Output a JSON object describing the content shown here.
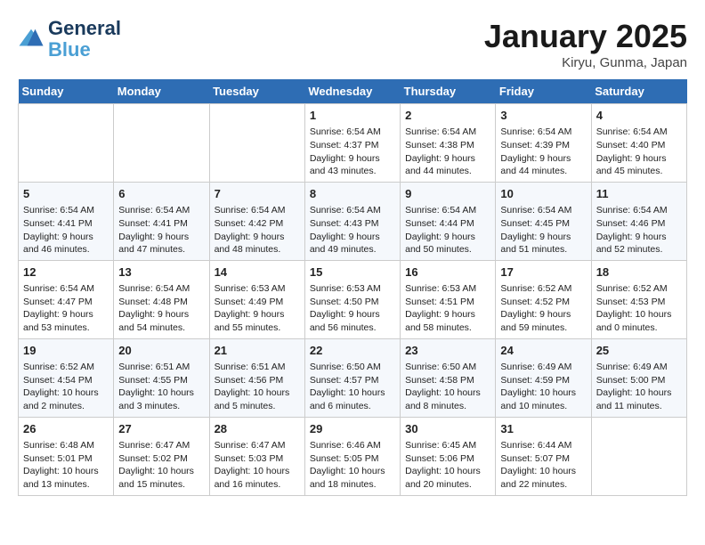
{
  "logo": {
    "line1": "General",
    "line2": "Blue"
  },
  "title": "January 2025",
  "location": "Kiryu, Gunma, Japan",
  "days_of_week": [
    "Sunday",
    "Monday",
    "Tuesday",
    "Wednesday",
    "Thursday",
    "Friday",
    "Saturday"
  ],
  "weeks": [
    [
      {
        "num": "",
        "info": ""
      },
      {
        "num": "",
        "info": ""
      },
      {
        "num": "",
        "info": ""
      },
      {
        "num": "1",
        "info": "Sunrise: 6:54 AM\nSunset: 4:37 PM\nDaylight: 9 hours\nand 43 minutes."
      },
      {
        "num": "2",
        "info": "Sunrise: 6:54 AM\nSunset: 4:38 PM\nDaylight: 9 hours\nand 44 minutes."
      },
      {
        "num": "3",
        "info": "Sunrise: 6:54 AM\nSunset: 4:39 PM\nDaylight: 9 hours\nand 44 minutes."
      },
      {
        "num": "4",
        "info": "Sunrise: 6:54 AM\nSunset: 4:40 PM\nDaylight: 9 hours\nand 45 minutes."
      }
    ],
    [
      {
        "num": "5",
        "info": "Sunrise: 6:54 AM\nSunset: 4:41 PM\nDaylight: 9 hours\nand 46 minutes."
      },
      {
        "num": "6",
        "info": "Sunrise: 6:54 AM\nSunset: 4:41 PM\nDaylight: 9 hours\nand 47 minutes."
      },
      {
        "num": "7",
        "info": "Sunrise: 6:54 AM\nSunset: 4:42 PM\nDaylight: 9 hours\nand 48 minutes."
      },
      {
        "num": "8",
        "info": "Sunrise: 6:54 AM\nSunset: 4:43 PM\nDaylight: 9 hours\nand 49 minutes."
      },
      {
        "num": "9",
        "info": "Sunrise: 6:54 AM\nSunset: 4:44 PM\nDaylight: 9 hours\nand 50 minutes."
      },
      {
        "num": "10",
        "info": "Sunrise: 6:54 AM\nSunset: 4:45 PM\nDaylight: 9 hours\nand 51 minutes."
      },
      {
        "num": "11",
        "info": "Sunrise: 6:54 AM\nSunset: 4:46 PM\nDaylight: 9 hours\nand 52 minutes."
      }
    ],
    [
      {
        "num": "12",
        "info": "Sunrise: 6:54 AM\nSunset: 4:47 PM\nDaylight: 9 hours\nand 53 minutes."
      },
      {
        "num": "13",
        "info": "Sunrise: 6:54 AM\nSunset: 4:48 PM\nDaylight: 9 hours\nand 54 minutes."
      },
      {
        "num": "14",
        "info": "Sunrise: 6:53 AM\nSunset: 4:49 PM\nDaylight: 9 hours\nand 55 minutes."
      },
      {
        "num": "15",
        "info": "Sunrise: 6:53 AM\nSunset: 4:50 PM\nDaylight: 9 hours\nand 56 minutes."
      },
      {
        "num": "16",
        "info": "Sunrise: 6:53 AM\nSunset: 4:51 PM\nDaylight: 9 hours\nand 58 minutes."
      },
      {
        "num": "17",
        "info": "Sunrise: 6:52 AM\nSunset: 4:52 PM\nDaylight: 9 hours\nand 59 minutes."
      },
      {
        "num": "18",
        "info": "Sunrise: 6:52 AM\nSunset: 4:53 PM\nDaylight: 10 hours\nand 0 minutes."
      }
    ],
    [
      {
        "num": "19",
        "info": "Sunrise: 6:52 AM\nSunset: 4:54 PM\nDaylight: 10 hours\nand 2 minutes."
      },
      {
        "num": "20",
        "info": "Sunrise: 6:51 AM\nSunset: 4:55 PM\nDaylight: 10 hours\nand 3 minutes."
      },
      {
        "num": "21",
        "info": "Sunrise: 6:51 AM\nSunset: 4:56 PM\nDaylight: 10 hours\nand 5 minutes."
      },
      {
        "num": "22",
        "info": "Sunrise: 6:50 AM\nSunset: 4:57 PM\nDaylight: 10 hours\nand 6 minutes."
      },
      {
        "num": "23",
        "info": "Sunrise: 6:50 AM\nSunset: 4:58 PM\nDaylight: 10 hours\nand 8 minutes."
      },
      {
        "num": "24",
        "info": "Sunrise: 6:49 AM\nSunset: 4:59 PM\nDaylight: 10 hours\nand 10 minutes."
      },
      {
        "num": "25",
        "info": "Sunrise: 6:49 AM\nSunset: 5:00 PM\nDaylight: 10 hours\nand 11 minutes."
      }
    ],
    [
      {
        "num": "26",
        "info": "Sunrise: 6:48 AM\nSunset: 5:01 PM\nDaylight: 10 hours\nand 13 minutes."
      },
      {
        "num": "27",
        "info": "Sunrise: 6:47 AM\nSunset: 5:02 PM\nDaylight: 10 hours\nand 15 minutes."
      },
      {
        "num": "28",
        "info": "Sunrise: 6:47 AM\nSunset: 5:03 PM\nDaylight: 10 hours\nand 16 minutes."
      },
      {
        "num": "29",
        "info": "Sunrise: 6:46 AM\nSunset: 5:05 PM\nDaylight: 10 hours\nand 18 minutes."
      },
      {
        "num": "30",
        "info": "Sunrise: 6:45 AM\nSunset: 5:06 PM\nDaylight: 10 hours\nand 20 minutes."
      },
      {
        "num": "31",
        "info": "Sunrise: 6:44 AM\nSunset: 5:07 PM\nDaylight: 10 hours\nand 22 minutes."
      },
      {
        "num": "",
        "info": ""
      }
    ]
  ]
}
